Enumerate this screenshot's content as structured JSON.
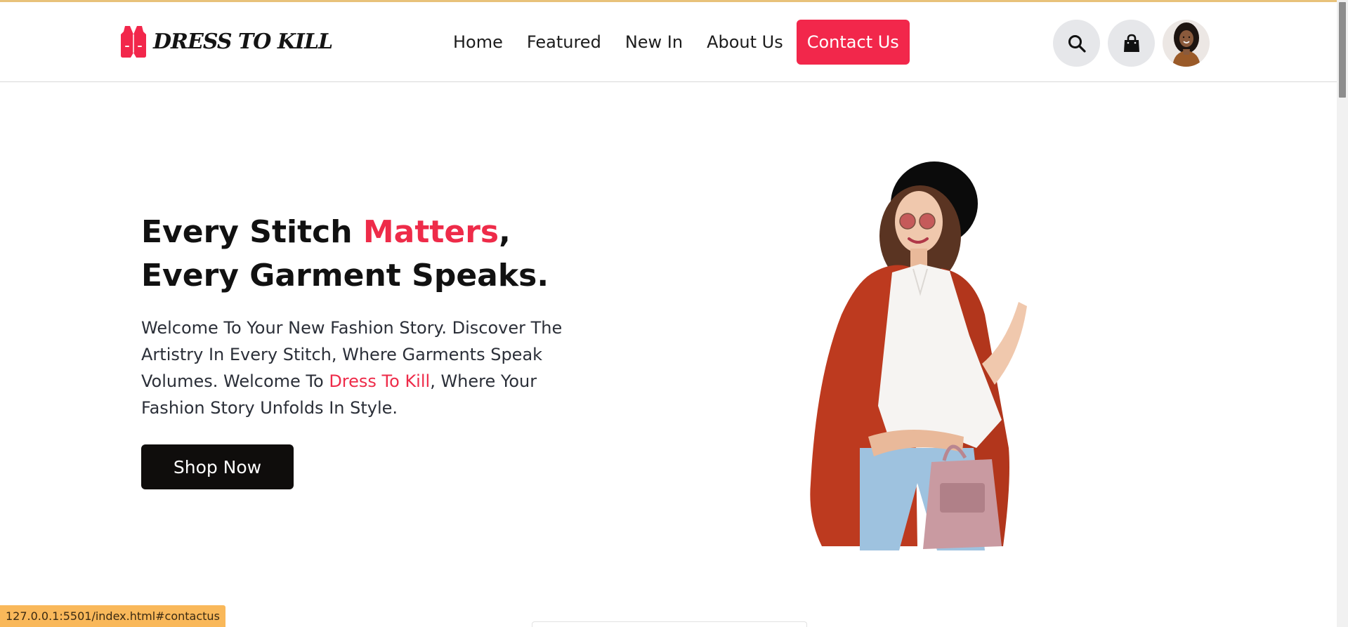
{
  "brand": {
    "name": "DRESS TO KILL",
    "accent_color": "#f2274b",
    "logo_icon": "vest-icon"
  },
  "nav": {
    "items": [
      {
        "label": "Home"
      },
      {
        "label": "Featured"
      },
      {
        "label": "New In"
      },
      {
        "label": "About Us"
      }
    ],
    "contact_label": "Contact Us"
  },
  "header_actions": {
    "search_icon": "search-icon",
    "cart_icon": "shopping-bag-icon",
    "avatar": "user-avatar"
  },
  "hero": {
    "title_part1": "Every Stitch ",
    "title_highlight": "Matters",
    "title_part2": ", Every Garment Speaks.",
    "text_part1": "Welcome To Your New Fashion Story. Discover The Artistry In Every Stitch, Where Garments Speak Volumes. Welcome To ",
    "text_highlight": "Dress To Kill",
    "text_part2": ", Where Your Fashion Story Unfolds In Style.",
    "cta_label": "Shop Now",
    "image": "model-in-red-jacket-and-black-hat"
  },
  "status_bar": {
    "url": "127.0.0.1:5501/index.html#contactus"
  }
}
